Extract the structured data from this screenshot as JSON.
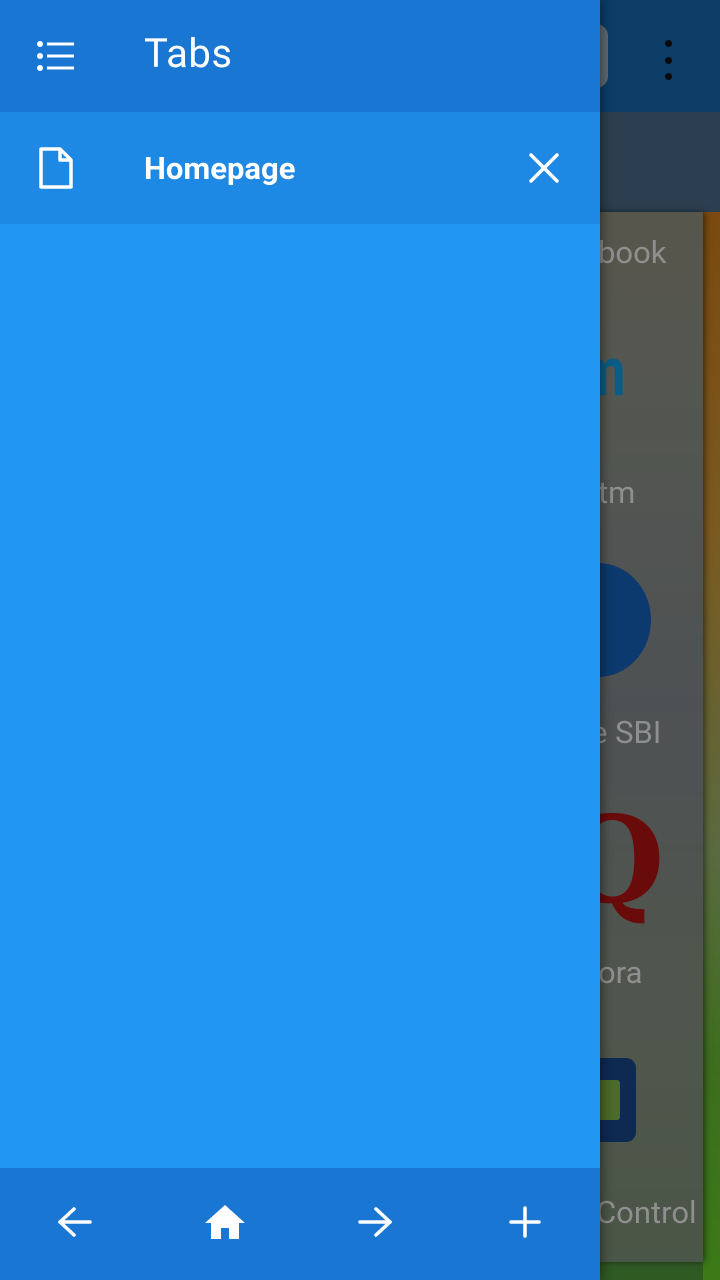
{
  "drawer": {
    "title": "Tabs",
    "tabs": [
      {
        "label": "Homepage"
      }
    ]
  },
  "background_page": {
    "shortcut_labels": [
      "book",
      "tm",
      "e SBI",
      "ora",
      "Control"
    ],
    "logo_text": "tm",
    "quora_letter": "Q"
  },
  "bottom_bar": {
    "buttons": [
      "back",
      "home",
      "forward",
      "new-tab"
    ]
  },
  "colors": {
    "drawer_bg": "#2196f3",
    "header_bg": "#1976d2",
    "active_tab_bg": "#1e88e5",
    "icon": "#ffffff"
  }
}
